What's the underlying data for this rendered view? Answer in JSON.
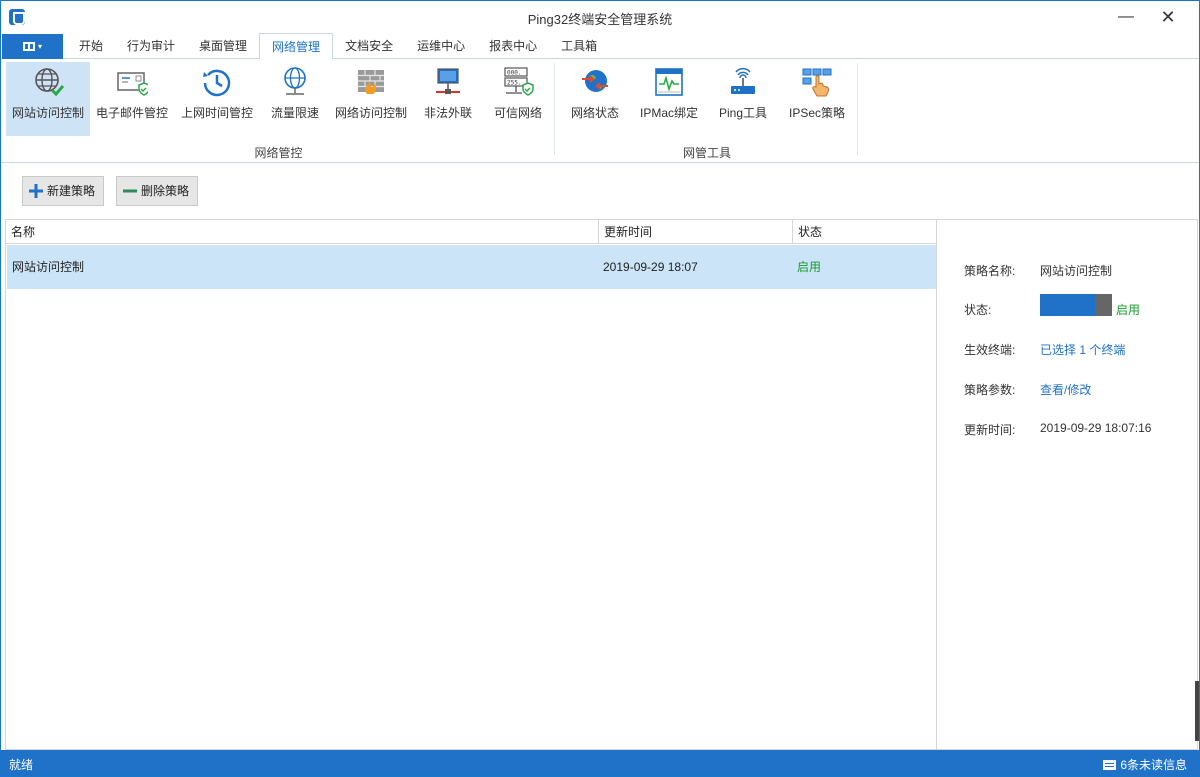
{
  "window": {
    "title": "Ping32终端安全管理系统",
    "minimize": "—",
    "close": "✕"
  },
  "tabs": {
    "file_caret": "▾",
    "items": [
      "开始",
      "行为审计",
      "桌面管理",
      "网络管理",
      "文档安全",
      "运维中心",
      "报表中心",
      "工具箱"
    ],
    "active": "网络管理"
  },
  "ribbon": {
    "groups": [
      {
        "label": "网络管控",
        "buttons": [
          {
            "label": "网站访问控制",
            "icon": "globe-check-icon",
            "selected": true
          },
          {
            "label": "电子邮件管控",
            "icon": "email-shield-icon"
          },
          {
            "label": "上网时间管控",
            "icon": "clock-history-icon"
          },
          {
            "label": "流量限速",
            "icon": "globe-network-icon"
          },
          {
            "label": "网络访问控制",
            "icon": "firewall-icon"
          },
          {
            "label": "非法外联",
            "icon": "monitor-network-icon"
          },
          {
            "label": "可信网络",
            "icon": "trusted-network-icon"
          }
        ]
      },
      {
        "label": "网管工具",
        "buttons": [
          {
            "label": "网络状态",
            "icon": "network-status-icon"
          },
          {
            "label": "IPMac绑定",
            "icon": "ipmac-bind-icon"
          },
          {
            "label": "Ping工具",
            "icon": "router-icon"
          },
          {
            "label": "IPSec策略",
            "icon": "ipsec-policy-icon"
          }
        ]
      }
    ]
  },
  "toolbar": {
    "new_label": "新建策略",
    "delete_label": "删除策略"
  },
  "grid": {
    "columns": [
      "名称",
      "更新时间",
      "状态"
    ],
    "rows": [
      {
        "name": "网站访问控制",
        "time": "2019-09-29 18:07",
        "status": "启用"
      }
    ]
  },
  "details": {
    "name_label": "策略名称:",
    "name_value": "网站访问控制",
    "status_label": "状态:",
    "status_value": "启用",
    "terminals_label": "生效终端:",
    "terminals_value": "已选择 1 个终端",
    "params_label": "策略参数:",
    "params_value": "查看/修改",
    "updated_label": "更新时间:",
    "updated_value": "2019-09-29 18:07:16"
  },
  "statusbar": {
    "left": "就绪",
    "right": "6条未读信息"
  },
  "colors": {
    "accent": "#1f72c8",
    "selected_row": "#cce4f7",
    "enabled_green": "#1a9a2e"
  }
}
